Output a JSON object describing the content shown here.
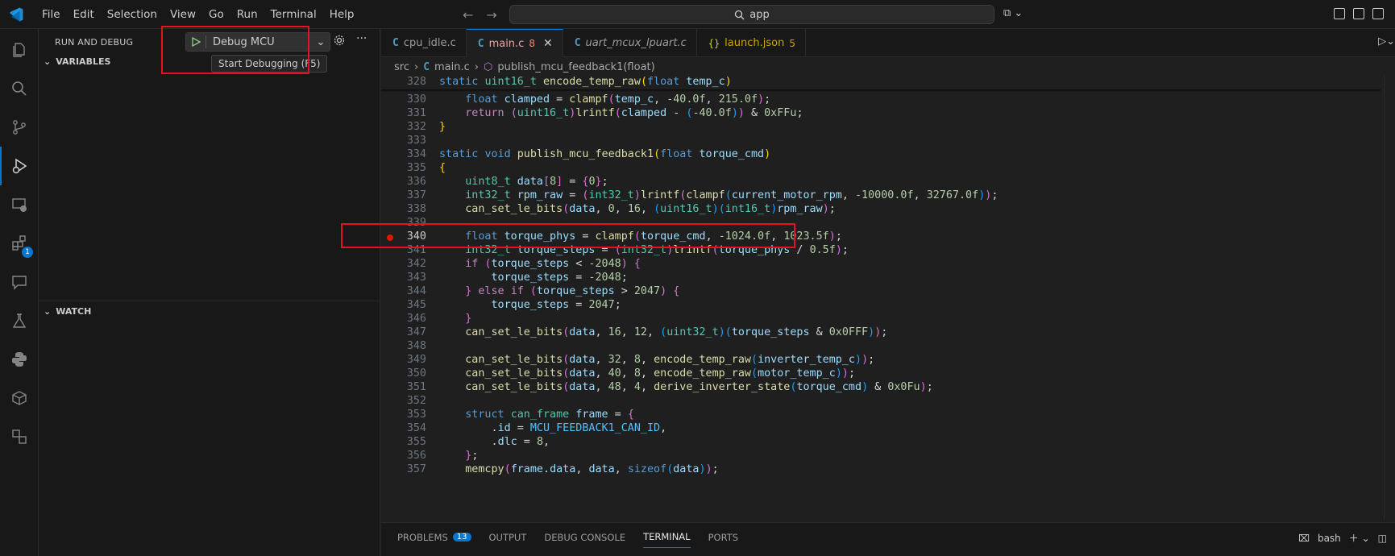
{
  "titlebar": {
    "menu": [
      "File",
      "Edit",
      "Selection",
      "View",
      "Go",
      "Run",
      "Terminal",
      "Help"
    ],
    "search_text": "app"
  },
  "activity": {
    "icons": [
      "explorer-icon",
      "search-icon",
      "source-control-icon",
      "run-debug-icon",
      "remote-explorer-icon",
      "extensions-icon",
      "chat-icon",
      "test-icon",
      "python-icon",
      "containers-icon",
      "accounts-icon"
    ],
    "extensions_badge": "1"
  },
  "sidebar": {
    "title": "RUN AND DEBUG",
    "config_label": "Debug MCU",
    "tooltip": "Start Debugging (F5)",
    "variables_label": "VARIABLES",
    "watch_label": "WATCH"
  },
  "tabs": [
    {
      "name": "cpu_idle.c",
      "badge": ""
    },
    {
      "name": "main.c",
      "badge": "8"
    },
    {
      "name": "uart_mcux_lpuart.c",
      "badge": ""
    },
    {
      "name": "launch.json",
      "badge": "5"
    }
  ],
  "breadcrumb": {
    "folder": "src",
    "file": "main.c",
    "symbol": "publish_mcu_feedback1(float)"
  },
  "code": {
    "line_numbers": [
      "328",
      "330",
      "331",
      "332",
      "333",
      "334",
      "335",
      "336",
      "337",
      "338",
      "339",
      "340",
      "341",
      "342",
      "343",
      "344",
      "345",
      "346",
      "347",
      "348",
      "349",
      "350",
      "351",
      "352",
      "353",
      "354",
      "355",
      "356",
      "357"
    ],
    "current_line": "340",
    "breakpoint_line": "340"
  },
  "panel": {
    "tabs": [
      "PROBLEMS",
      "OUTPUT",
      "DEBUG CONSOLE",
      "TERMINAL",
      "PORTS"
    ],
    "problems_count": "13",
    "active": "TERMINAL",
    "shell": "bash"
  },
  "colors": {
    "accent": "#0078d4",
    "highlight": "#e81123",
    "breakpoint": "#e51400"
  }
}
